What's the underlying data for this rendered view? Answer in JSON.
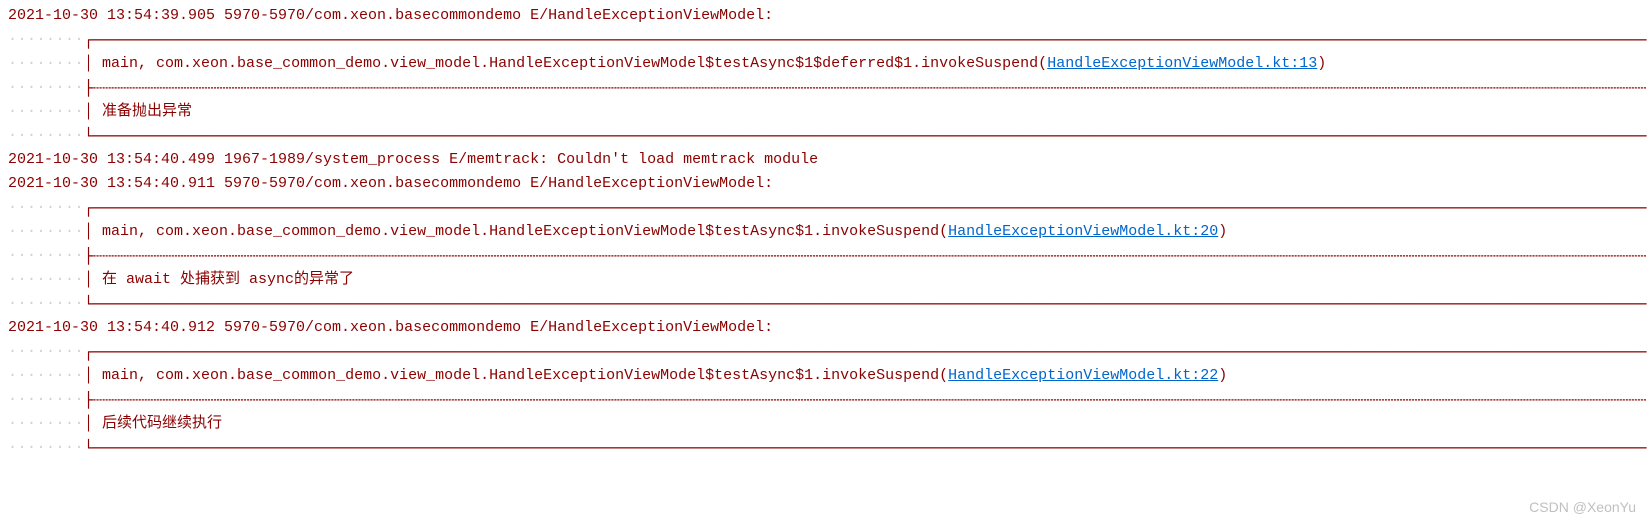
{
  "watermark": "CSDN @XeonYu",
  "whitespace_dots": "····",
  "whitespace_dots_short": "···",
  "entries": {
    "0": {
      "header": "2021-10-30 13:54:39.905 5970-5970/com.xeon.basecommondemo E/HandleExceptionViewModel: ",
      "box_top": "┌────────────────────────────────────────────────────────────────────────────────────────────────────────────────────────────────────────────────────────────────────────────",
      "line1_prefix": "│ main, com.xeon.base_common_demo.view_model.HandleExceptionViewModel$testAsync$1$deferred$1.invokeSuspend(",
      "line1_link": "HandleExceptionViewModel.kt:13",
      "line1_suffix": ")",
      "box_mid": "├┄┄┄┄┄┄┄┄┄┄┄┄┄┄┄┄┄┄┄┄┄┄┄┄┄┄┄┄┄┄┄┄┄┄┄┄┄┄┄┄┄┄┄┄┄┄┄┄┄┄┄┄┄┄┄┄┄┄┄┄┄┄┄┄┄┄┄┄┄┄┄┄┄┄┄┄┄┄┄┄┄┄┄┄┄┄┄┄┄┄┄┄┄┄┄┄┄┄┄┄┄┄┄┄┄┄┄┄┄┄┄┄┄┄┄┄┄┄┄┄┄┄┄┄┄┄┄┄┄┄┄┄┄┄┄┄┄┄┄┄┄┄┄┄┄┄┄┄┄┄┄┄┄┄┄┄┄┄┄┄┄┄┄┄┄┄┄┄┄┄┄┄",
      "line2": "│ 准备抛出异常",
      "box_bot": "└────────────────────────────────────────────────────────────────────────────────────────────────────────────────────────────────────────────────────────────────────────────"
    },
    "1": {
      "header": "2021-10-30 13:54:40.499 1967-1989/system_process E/memtrack: Couldn't load memtrack module"
    },
    "2": {
      "header": "2021-10-30 13:54:40.911 5970-5970/com.xeon.basecommondemo E/HandleExceptionViewModel: ",
      "box_top": "┌────────────────────────────────────────────────────────────────────────────────────────────────────────────────────────────────────────────────────────────────────────────",
      "line1_prefix": "│ main, com.xeon.base_common_demo.view_model.HandleExceptionViewModel$testAsync$1.invokeSuspend(",
      "line1_link": "HandleExceptionViewModel.kt:20",
      "line1_suffix": ")",
      "box_mid": "├┄┄┄┄┄┄┄┄┄┄┄┄┄┄┄┄┄┄┄┄┄┄┄┄┄┄┄┄┄┄┄┄┄┄┄┄┄┄┄┄┄┄┄┄┄┄┄┄┄┄┄┄┄┄┄┄┄┄┄┄┄┄┄┄┄┄┄┄┄┄┄┄┄┄┄┄┄┄┄┄┄┄┄┄┄┄┄┄┄┄┄┄┄┄┄┄┄┄┄┄┄┄┄┄┄┄┄┄┄┄┄┄┄┄┄┄┄┄┄┄┄┄┄┄┄┄┄┄┄┄┄┄┄┄┄┄┄┄┄┄┄┄┄┄┄┄┄┄┄┄┄┄┄┄┄┄┄┄┄┄┄┄┄┄┄┄┄┄┄┄┄┄",
      "line2": "│ 在 await 处捕获到 async的异常了",
      "box_bot": "└────────────────────────────────────────────────────────────────────────────────────────────────────────────────────────────────────────────────────────────────────────────"
    },
    "3": {
      "header": "2021-10-30 13:54:40.912 5970-5970/com.xeon.basecommondemo E/HandleExceptionViewModel: ",
      "box_top": "┌────────────────────────────────────────────────────────────────────────────────────────────────────────────────────────────────────────────────────────────────────────────",
      "line1_prefix": "│ main, com.xeon.base_common_demo.view_model.HandleExceptionViewModel$testAsync$1.invokeSuspend(",
      "line1_link": "HandleExceptionViewModel.kt:22",
      "line1_suffix": ")",
      "box_mid": "├┄┄┄┄┄┄┄┄┄┄┄┄┄┄┄┄┄┄┄┄┄┄┄┄┄┄┄┄┄┄┄┄┄┄┄┄┄┄┄┄┄┄┄┄┄┄┄┄┄┄┄┄┄┄┄┄┄┄┄┄┄┄┄┄┄┄┄┄┄┄┄┄┄┄┄┄┄┄┄┄┄┄┄┄┄┄┄┄┄┄┄┄┄┄┄┄┄┄┄┄┄┄┄┄┄┄┄┄┄┄┄┄┄┄┄┄┄┄┄┄┄┄┄┄┄┄┄┄┄┄┄┄┄┄┄┄┄┄┄┄┄┄┄┄┄┄┄┄┄┄┄┄┄┄┄┄┄┄┄┄┄┄┄┄┄┄┄┄┄┄┄┄",
      "line2": "│ 后续代码继续执行",
      "box_bot": "└────────────────────────────────────────────────────────────────────────────────────────────────────────────────────────────────────────────────────────────────────────────"
    }
  }
}
